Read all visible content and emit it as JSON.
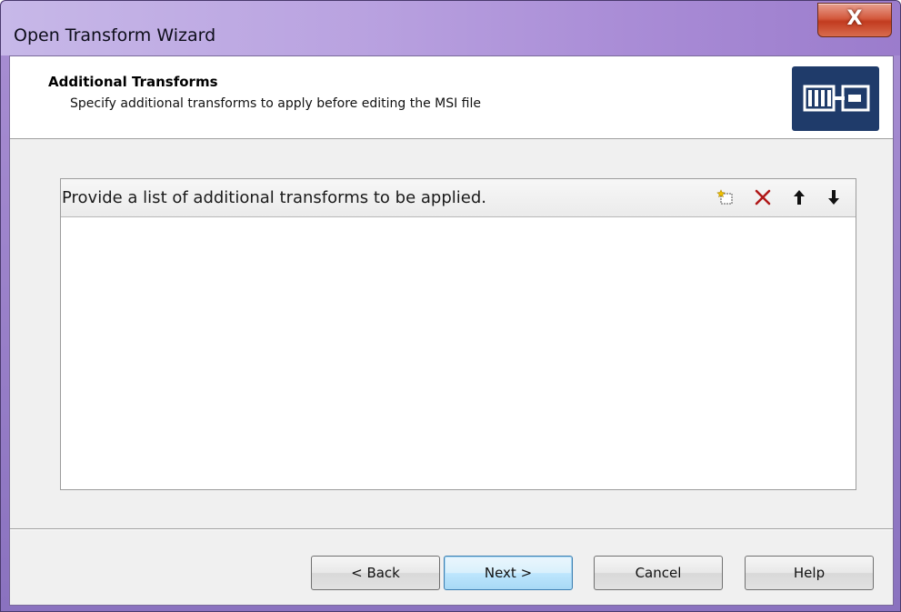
{
  "window": {
    "title": "Open Transform Wizard",
    "close_label": "X"
  },
  "header": {
    "title": "Additional Transforms",
    "subtitle": "Specify additional transforms to apply before editing the MSI file",
    "icon": "transform-icon"
  },
  "panel": {
    "label": "Provide a list of additional transforms to be applied.",
    "tools": [
      {
        "name": "new-item-icon"
      },
      {
        "name": "delete-icon",
        "color": "#b01818"
      },
      {
        "name": "move-up-icon"
      },
      {
        "name": "move-down-icon"
      }
    ],
    "items": []
  },
  "buttons": {
    "back": "< Back",
    "next": "Next >",
    "cancel": "Cancel",
    "help": "Help"
  }
}
